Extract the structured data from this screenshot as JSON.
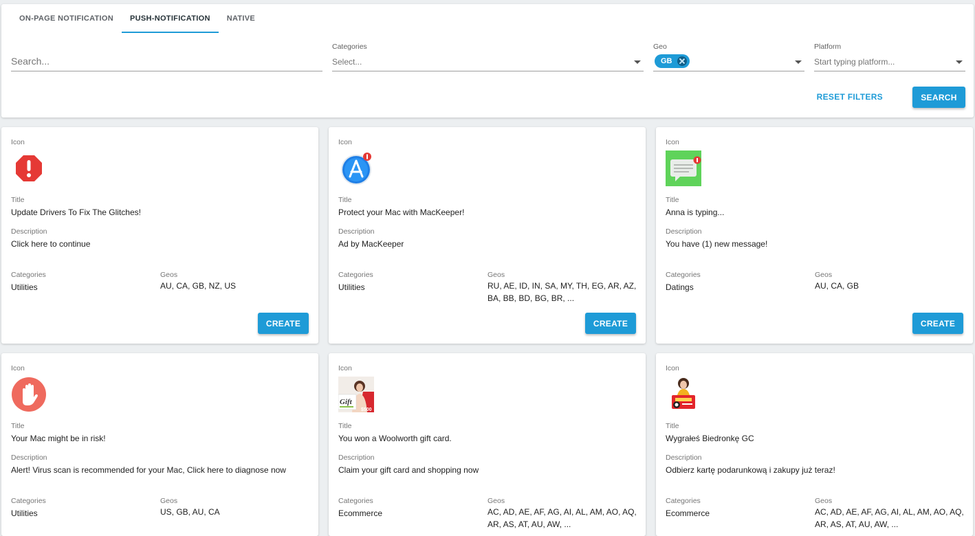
{
  "tabs": [
    {
      "label": "ON-PAGE NOTIFICATION"
    },
    {
      "label": "PUSH-NOTIFICATION"
    },
    {
      "label": "NATIVE"
    }
  ],
  "filters": {
    "search": {
      "placeholder": "Search..."
    },
    "categories": {
      "label": "Categories",
      "placeholder": "Select..."
    },
    "geo": {
      "label": "Geo",
      "chip": "GB"
    },
    "platform": {
      "label": "Platform",
      "placeholder": "Start typing platform..."
    },
    "reset_label": "RESET FILTERS",
    "search_label": "SEARCH"
  },
  "labels": {
    "icon": "Icon",
    "title": "Title",
    "description": "Description",
    "categories": "Categories",
    "geos": "Geos",
    "create": "CREATE"
  },
  "cards": [
    {
      "icon": "red-alert-octagon-icon",
      "title": "Update Drivers To Fix The Glitches!",
      "description": "Click here to continue",
      "categories": "Utilities",
      "geos": "AU, CA, GB, NZ, US"
    },
    {
      "icon": "app-store-icon",
      "title": "Protect your Mac with MacKeeper!",
      "description": "Ad by MacKeeper",
      "categories": "Utilities",
      "geos": "RU, AE, ID, IN, SA, MY, TH, EG, AR, AZ, BA, BB, BD, BG, BR, ..."
    },
    {
      "icon": "message-bubble-icon",
      "title": "Anna is typing...",
      "description": "You have (1) new message!",
      "categories": "Datings",
      "geos": "AU, CA, GB"
    },
    {
      "icon": "stop-hand-icon",
      "title": "Your Mac might be in risk!",
      "description": "Alert! Virus scan is recommended for your Mac, Click here to diagnose now",
      "categories": "Utilities",
      "geos": "US, GB, AU, CA"
    },
    {
      "icon": "gift-card-photo-icon",
      "icon_text": "Gift",
      "icon_price": "$500",
      "title": "You won a Woolworth gift card.",
      "description": "Claim your gift card and shopping now",
      "categories": "Ecommerce",
      "geos": "AC, AD, AE, AF, AG, AI, AL, AM, AO, AQ, AR, AS, AT, AU, AW, ..."
    },
    {
      "icon": "woman-with-gift-card-icon",
      "title": "Wygrałeś Biedronkę GC",
      "description": "Odbierz kartę podarunkową i zakupy już teraz!",
      "categories": "Ecommerce",
      "geos": "AC, AD, AE, AF, AG, AI, AL, AM, AO, AQ, AR, AS, AT, AU, AW, ..."
    }
  ],
  "colors": {
    "accent": "#1e9bd7",
    "background": "#eceff1"
  }
}
